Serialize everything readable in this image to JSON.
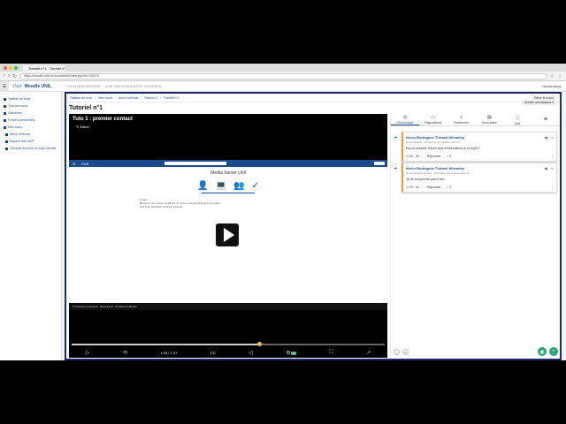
{
  "browser": {
    "tab_title": "Tutoriel n°1 - Tutoriel n°1",
    "url": "https://moodle.unil.ch/mod/videos/view.php?id=100374",
    "dot_colors": [
      "#ff5f57",
      "#ffbd2e",
      "#28c940"
    ]
  },
  "moodle": {
    "menu_icon": "hamburger-icon",
    "logo": "Unil",
    "brand": "Moodle UNIL",
    "topnav": [
      "TOUR DES CITOYENS",
      "VOIR VIDEOTHEQUES ET TUTORIELS"
    ],
    "user": "Nicolas Nova"
  },
  "sidebar": {
    "items": [
      {
        "label": "Tableau de bord",
        "sub": false
      },
      {
        "label": "Tous les cours",
        "sub": false
      },
      {
        "label": "Calendrier",
        "sub": false
      },
      {
        "label": "Fichiers personnels",
        "sub": false
      },
      {
        "label": "Mes cours",
        "sub": false
      },
      {
        "label": "Demo UniCast",
        "sub": true
      },
      {
        "label": "Espace test JAVP",
        "sub": true
      },
      {
        "label": "Tutoriels de prise en main Moodle",
        "sub": true
      }
    ]
  },
  "breadcrumb": [
    "Tableau de bord",
    "Mes cours",
    "demo UniCast",
    "Section 2",
    "Tutoriel n°1"
  ],
  "settings_label": "Gérer le cours",
  "page_title": "Tutoriel n°1",
  "video": {
    "title": "Tuto 1 : premier contact",
    "edit_label": "✎ Éditer",
    "inner": {
      "logo": "Unil",
      "site_title": "Media Server Unil",
      "text_heading": "Accueil",
      "text_lines": [
        "Bienvenue sur le serveur media Unil. Ce serveur vous permet de gérer vos vidéos.",
        "Pour toute information, contactez le support."
      ],
      "footer": "© Université de Lausanne · Media Server · Conditions d'utilisation"
    },
    "progress_fraction": 0.6,
    "time": "1:03 / 1:37",
    "hd": "HD"
  },
  "panel": {
    "annotations_button": "Activité annotations ▾",
    "tabs": [
      {
        "icon": "clock-icon",
        "label": "Chronologie"
      },
      {
        "icon": "monitor-icon",
        "label": "Diapositives"
      },
      {
        "icon": "search-icon",
        "label": "Recherche"
      },
      {
        "icon": "notes-icon",
        "label": "Sous-titres"
      },
      {
        "icon": "info-icon",
        "label": "Info"
      },
      {
        "icon": "close-icon",
        "label": ""
      }
    ],
    "notes": [
      {
        "author": "Kevin Rodrigues Thirbell Wheatley",
        "meta": "Commentaire · 10 heures, 23 minutes plus tôt",
        "body": "Est-ce possible d'avoir plus d'informations à ce sujet ?",
        "time": "00 : 30",
        "reply": "Répondre",
        "likes": "0"
      },
      {
        "author": "Kevin Rodrigues Thirbell Wheatley",
        "meta": "Je ne comprends pas · 10 heures, 24 minutes plus tôt",
        "body": "Je ne comprends pas le lien",
        "time": "00 : 42",
        "reply": "Répondre",
        "likes": "0"
      }
    ]
  }
}
